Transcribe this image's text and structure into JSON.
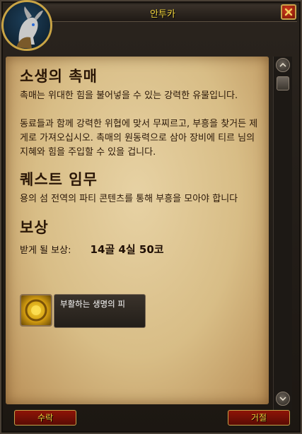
{
  "window": {
    "title": "안투카"
  },
  "quest": {
    "title": "소생의 촉매",
    "description_1": "촉매는 위대한 힘을 불어넣을 수 있는 강력한 유물입니다.",
    "description_2": "동료들과 함께 강력한 위협에 맞서 무찌르고, 부흥을 찾거든 제게로 가져오십시오. 촉매의 원동력으로 삼아 장비에 티르 님의 지혜와 힘을 주입할 수 있을 겁니다.",
    "objectives_title": "퀘스트 임무",
    "objectives": "용의 섬 전역의 파티 콘텐츠를 통해 부흥을 모아야 합니다",
    "rewards_title": "보상",
    "rewards_label": "받게 될 보상:",
    "money": "14골 4실 50코",
    "reward_item": {
      "name": "부활하는 생명의 피",
      "icon": "golden-orb-icon"
    }
  },
  "buttons": {
    "accept": "수락",
    "decline": "거절"
  },
  "colors": {
    "title_gold": "#f0d23c",
    "button_red": "#8e1407",
    "parchment": "#e0c894"
  }
}
